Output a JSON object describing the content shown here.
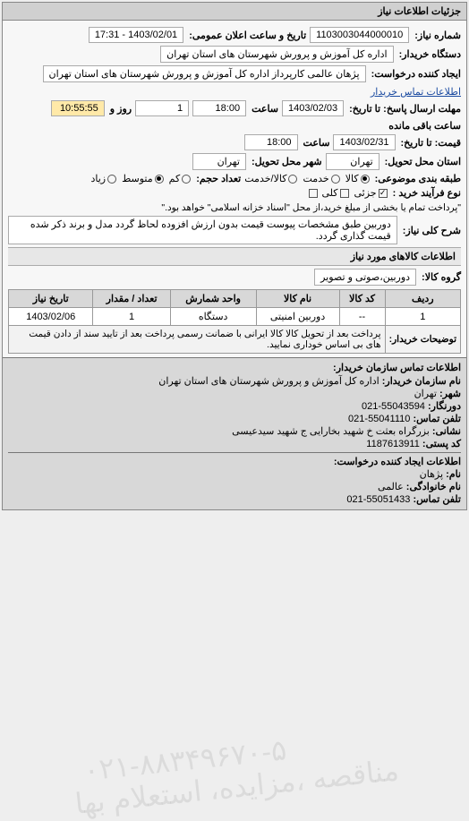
{
  "panel_title": "جزئیات اطلاعات نیاز",
  "request_no_label": "شماره نیاز:",
  "request_no": "1103003044000010",
  "announce_label": "تاریخ و ساعت اعلان عمومی:",
  "announce_value": "1403/02/01 - 17:31",
  "buyer_label": "دستگاه خریدار:",
  "buyer_value": "اداره کل آموزش و پرورش شهرستان های استان تهران",
  "requester_label": "ایجاد کننده درخواست:",
  "requester_value": "پژهان عالمی کارپرداز اداره کل آموزش و پرورش شهرستان های استان تهران",
  "contact_link": "اطلاعات تماس خریدار",
  "deadline_reply_label": "مهلت ارسال پاسخ: تا تاریخ:",
  "deadline_reply_date": "1403/02/03",
  "deadline_reply_time_label": "ساعت",
  "deadline_reply_time": "18:00",
  "remaining_days": "1",
  "remaining_days_label": "روز و",
  "remaining_time": "10:55:55",
  "remaining_time_label": "ساعت باقی مانده",
  "quote_label": "قیمت: تا تاریخ:",
  "quote_date": "1403/02/31",
  "quote_time_label": "ساعت",
  "quote_time": "18:00",
  "province_label": "استان محل تحویل:",
  "province": "تهران",
  "city_label": "شهر محل تحویل:",
  "city": "تهران",
  "pack_label": "طبقه بندی موضوعی:",
  "pack_opts": {
    "a": "کالا",
    "b": "خدمت",
    "c": "کالا/خدمت"
  },
  "pack_selected": "a",
  "qty_label": "تعداد حجم:",
  "qty_opts": {
    "a": "کم",
    "b": "متوسط",
    "c": "زیاد"
  },
  "qty_selected": "b",
  "proc_label": "نوع فرآیند خرید :",
  "proc_opts": {
    "partial": "جزئی",
    "full": "کلی"
  },
  "proc_selected": "partial",
  "proc_note": "\"پرداخت تمام یا بخشی از مبلغ خرید،از محل \"اسناد خزانه اسلامی\" خواهد بود.\"",
  "proc_note_checked": false,
  "need_title_label": "شرح کلی نیاز:",
  "need_title": "دوربین طبق مشخصات پیوست قیمت بدون ارزش افزوده لحاظ گردد مدل و برند ذکر شده قیمت گذاری گردد.",
  "items_header": "اطلاعات کالاهای مورد نیاز",
  "group_label": "گروه کالا:",
  "group_value": "دوربین،صوتی و تصویر",
  "table": {
    "headers": [
      "ردیف",
      "کد کالا",
      "نام کالا",
      "واحد شمارش",
      "تعداد / مقدار",
      "تاریخ نیاز"
    ],
    "rows": [
      {
        "idx": "1",
        "code": "--",
        "name": "دوربین امنیتی",
        "unit": "دستگاه",
        "qty": "1",
        "date": "1403/02/06"
      }
    ]
  },
  "notes_label": "توضیحات خریدار:",
  "notes_value": "پرداخت بعد از تحویل کالا کالا ایرانی با ضمانت رسمی پرداخت بعد از تایید سند از دادن قیمت های بی اساس خوداری نمایید.",
  "contact": {
    "header": "اطلاعات تماس سازمان خریدار:",
    "org_label": "نام سازمان خریدار:",
    "org": "اداره کل آموزش و پرورش شهرستان های استان تهران",
    "city_label": "شهر:",
    "city": "تهران",
    "fax_label": "دورنگار:",
    "fax": "55043594-021",
    "phone_label": "تلفن تماس:",
    "phone": "55041110-021",
    "addr_label": "نشانی:",
    "addr": "بزرگراه بعثت خ شهید بخارایی ج شهید سیدعیسی",
    "post_label": "کد پستی:",
    "post": "1187613911",
    "sub_header": "اطلاعات ایجاد کننده درخواست:",
    "name_label": "نام:",
    "name": "پژهان",
    "fam_label": "نام خانوادگی:",
    "fam": "عالمی",
    "phone2_label": "تلفن تماس:",
    "phone2": "55051433-021"
  },
  "watermark1": "۰۲۱-۸۸۳۴۹۶۷۰-۵",
  "watermark2": "مناقصه ،مزایده، استعلام بها"
}
